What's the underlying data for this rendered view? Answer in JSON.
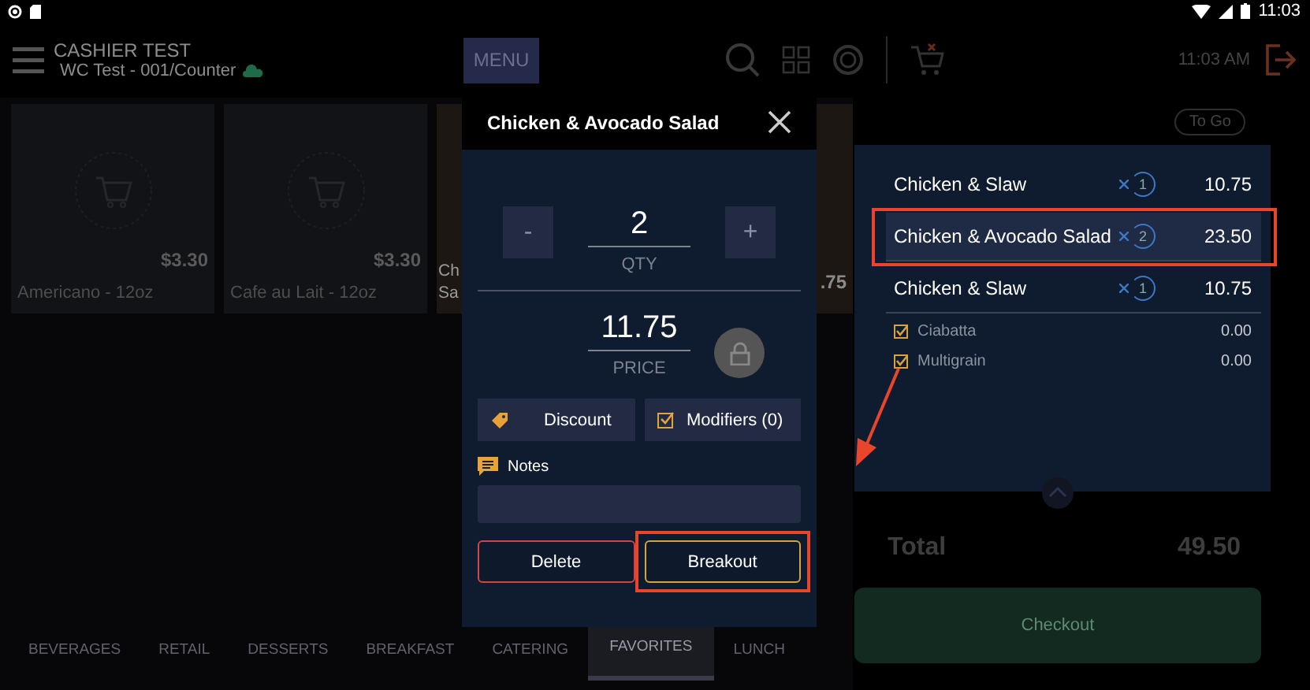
{
  "status_bar": {
    "time": "11:03"
  },
  "header": {
    "title": "CASHIER TEST",
    "subtitle": "WC Test - 001/Counter",
    "menu_button": "MENU",
    "time": "11:03 AM"
  },
  "products": [
    {
      "kind": "placeholder",
      "name_lines": [
        "Americano - 12oz"
      ],
      "price": "$3.30"
    },
    {
      "kind": "placeholder",
      "name_lines": [
        "Cafe au Lait - 12oz"
      ],
      "price": "$3.30"
    },
    {
      "kind": "photo",
      "name_lines": [
        "Ch",
        "Sa"
      ]
    },
    {
      "kind": "photo",
      "price": ".75"
    }
  ],
  "categories": [
    {
      "label": "BEVERAGES",
      "selected": false
    },
    {
      "label": "RETAIL",
      "selected": false
    },
    {
      "label": "DESSERTS",
      "selected": false
    },
    {
      "label": "BREAKFAST",
      "selected": false
    },
    {
      "label": "CATERING",
      "selected": false
    },
    {
      "label": "FAVORITES",
      "selected": true
    },
    {
      "label": "LUNCH",
      "selected": false
    }
  ],
  "order": {
    "order_type": "To Go",
    "items": [
      {
        "name": "Chicken & Slaw",
        "qty": "1",
        "price": "10.75",
        "selected": false,
        "annotated": false
      },
      {
        "name": "Chicken & Avocado Salad",
        "qty": "2",
        "price": "23.50",
        "selected": true,
        "annotated": true
      },
      {
        "name": "Chicken & Slaw",
        "qty": "1",
        "price": "10.75",
        "selected": false,
        "annotated": false,
        "modifiers": [
          {
            "name": "Ciabatta",
            "price": "0.00",
            "checked": true
          },
          {
            "name": "Multigrain",
            "price": "0.00",
            "checked": true
          }
        ]
      }
    ],
    "total_label": "Total",
    "total": "49.50",
    "checkout": "Checkout"
  },
  "modal": {
    "title": "Chicken & Avocado Salad",
    "minus": "-",
    "plus": "+",
    "qty": "2",
    "qty_label": "QTY",
    "price": "11.75",
    "price_label": "PRICE",
    "price_locked": true,
    "actions": [
      {
        "kind": "discount",
        "label": "Discount"
      },
      {
        "kind": "modifiers",
        "label": "Modifiers (0)"
      }
    ],
    "notes_label": "Notes",
    "buttons": [
      {
        "kind": "delete",
        "label": "Delete",
        "annotated": false
      },
      {
        "kind": "breakout",
        "label": "Breakout",
        "annotated": true
      }
    ]
  }
}
